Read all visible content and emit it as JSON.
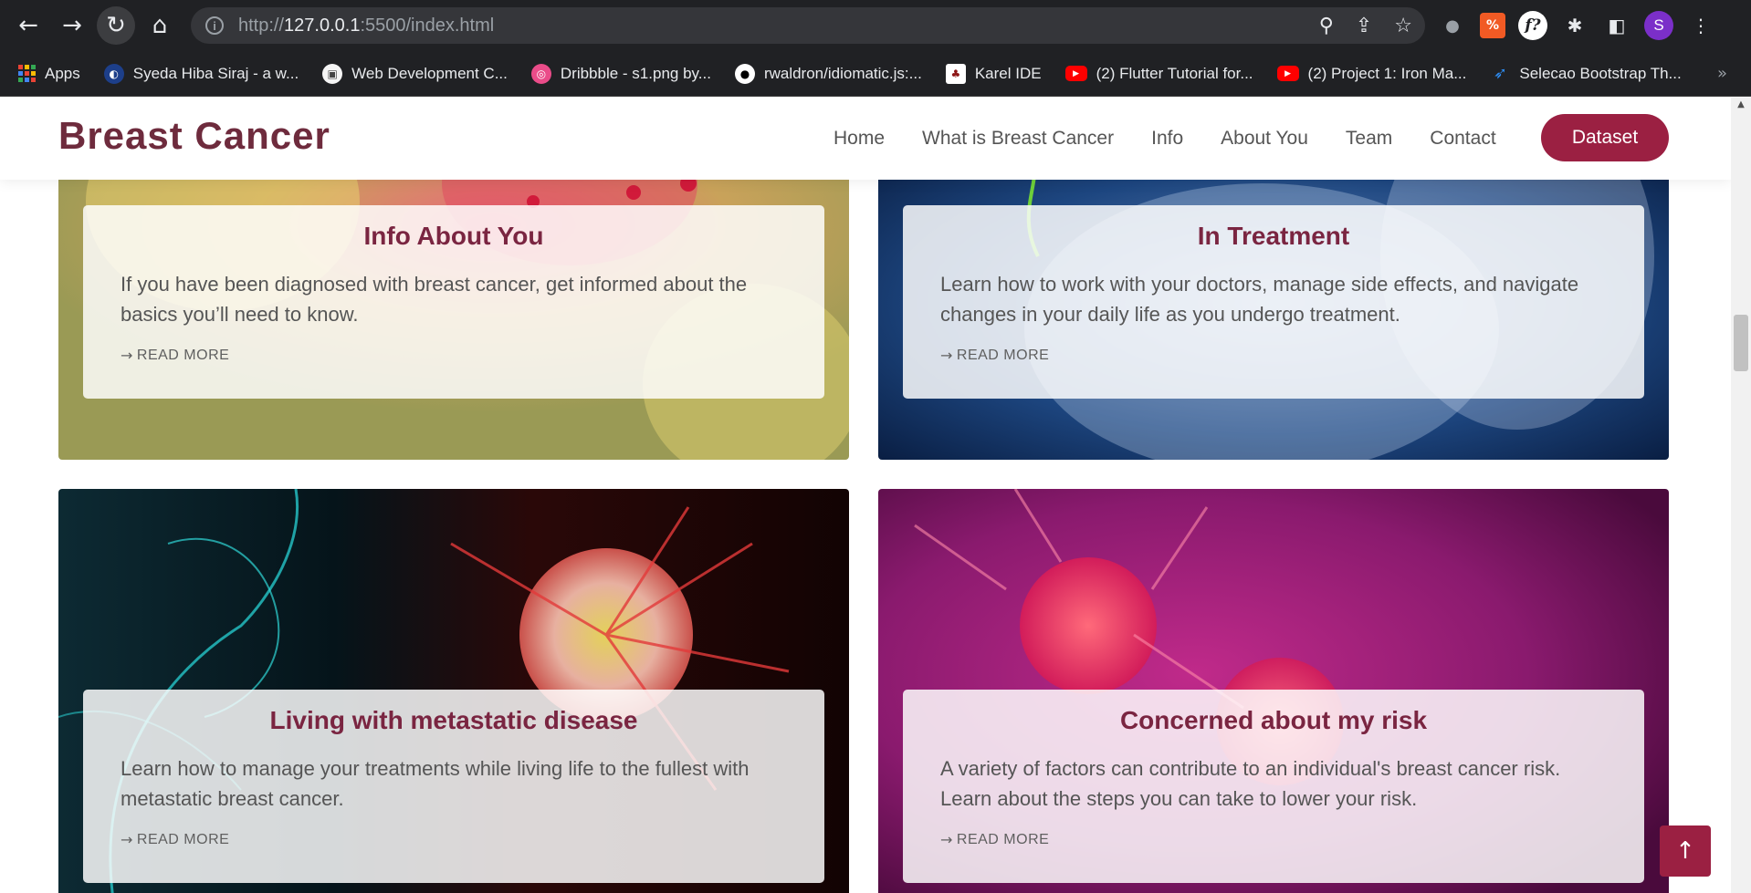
{
  "browser": {
    "url_prefix": "http://",
    "url_host": "127.0.0.1",
    "url_rest": ":5500/index.html",
    "icons": {
      "back": "arrow-left-icon",
      "forward": "arrow-right-icon",
      "reload": "reload-icon",
      "home": "home-icon",
      "zoom": "magnifier-icon",
      "share": "share-icon",
      "star": "star-icon"
    },
    "profile_initial": "S",
    "extension_label": "f?",
    "bookmarks": [
      {
        "label": "Apps",
        "icon": "apps-grid-icon"
      },
      {
        "label": "Syeda Hiba Siraj - a w...",
        "icon": "portfolio-icon"
      },
      {
        "label": "Web Development C...",
        "icon": "course-icon"
      },
      {
        "label": "Dribbble - s1.png by...",
        "icon": "dribbble-icon"
      },
      {
        "label": "rwaldron/idiomatic.js:...",
        "icon": "github-icon"
      },
      {
        "label": "Karel IDE",
        "icon": "stanford-icon"
      },
      {
        "label": "(2) Flutter Tutorial for...",
        "icon": "youtube-icon"
      },
      {
        "label": "(2) Project 1: Iron Ma...",
        "icon": "youtube-icon"
      },
      {
        "label": "Selecao Bootstrap Th...",
        "icon": "selecao-icon"
      }
    ]
  },
  "site": {
    "brand": "Breast Cancer",
    "nav": [
      "Home",
      "What is Breast Cancer",
      "Info",
      "About You",
      "Team",
      "Contact"
    ],
    "cta": "Dataset",
    "colors": {
      "accent": "#9b2042",
      "heading": "#7a2541",
      "brand": "#6e2b3d"
    }
  },
  "cards": [
    {
      "title": "Info About You",
      "text": "If you have been diagnosed with breast cancer, get informed about the basics you’ll need to know.",
      "link": "READ MORE"
    },
    {
      "title": "In Treatment",
      "text": "Learn how to work with your doctors, manage side effects, and navigate changes in your daily life as you undergo treatment.",
      "link": "READ MORE"
    },
    {
      "title": "Living with metastatic disease",
      "text": "Learn how to manage your treatments while living life to the fullest with metastatic breast cancer.",
      "link": "READ MORE"
    },
    {
      "title": "Concerned about my risk",
      "text": "A variety of factors can contribute to an individual's breast cancer risk. Learn about the steps you can take to lower your risk.",
      "link": "READ MORE"
    }
  ],
  "back_to_top_icon": "arrow-up-icon"
}
